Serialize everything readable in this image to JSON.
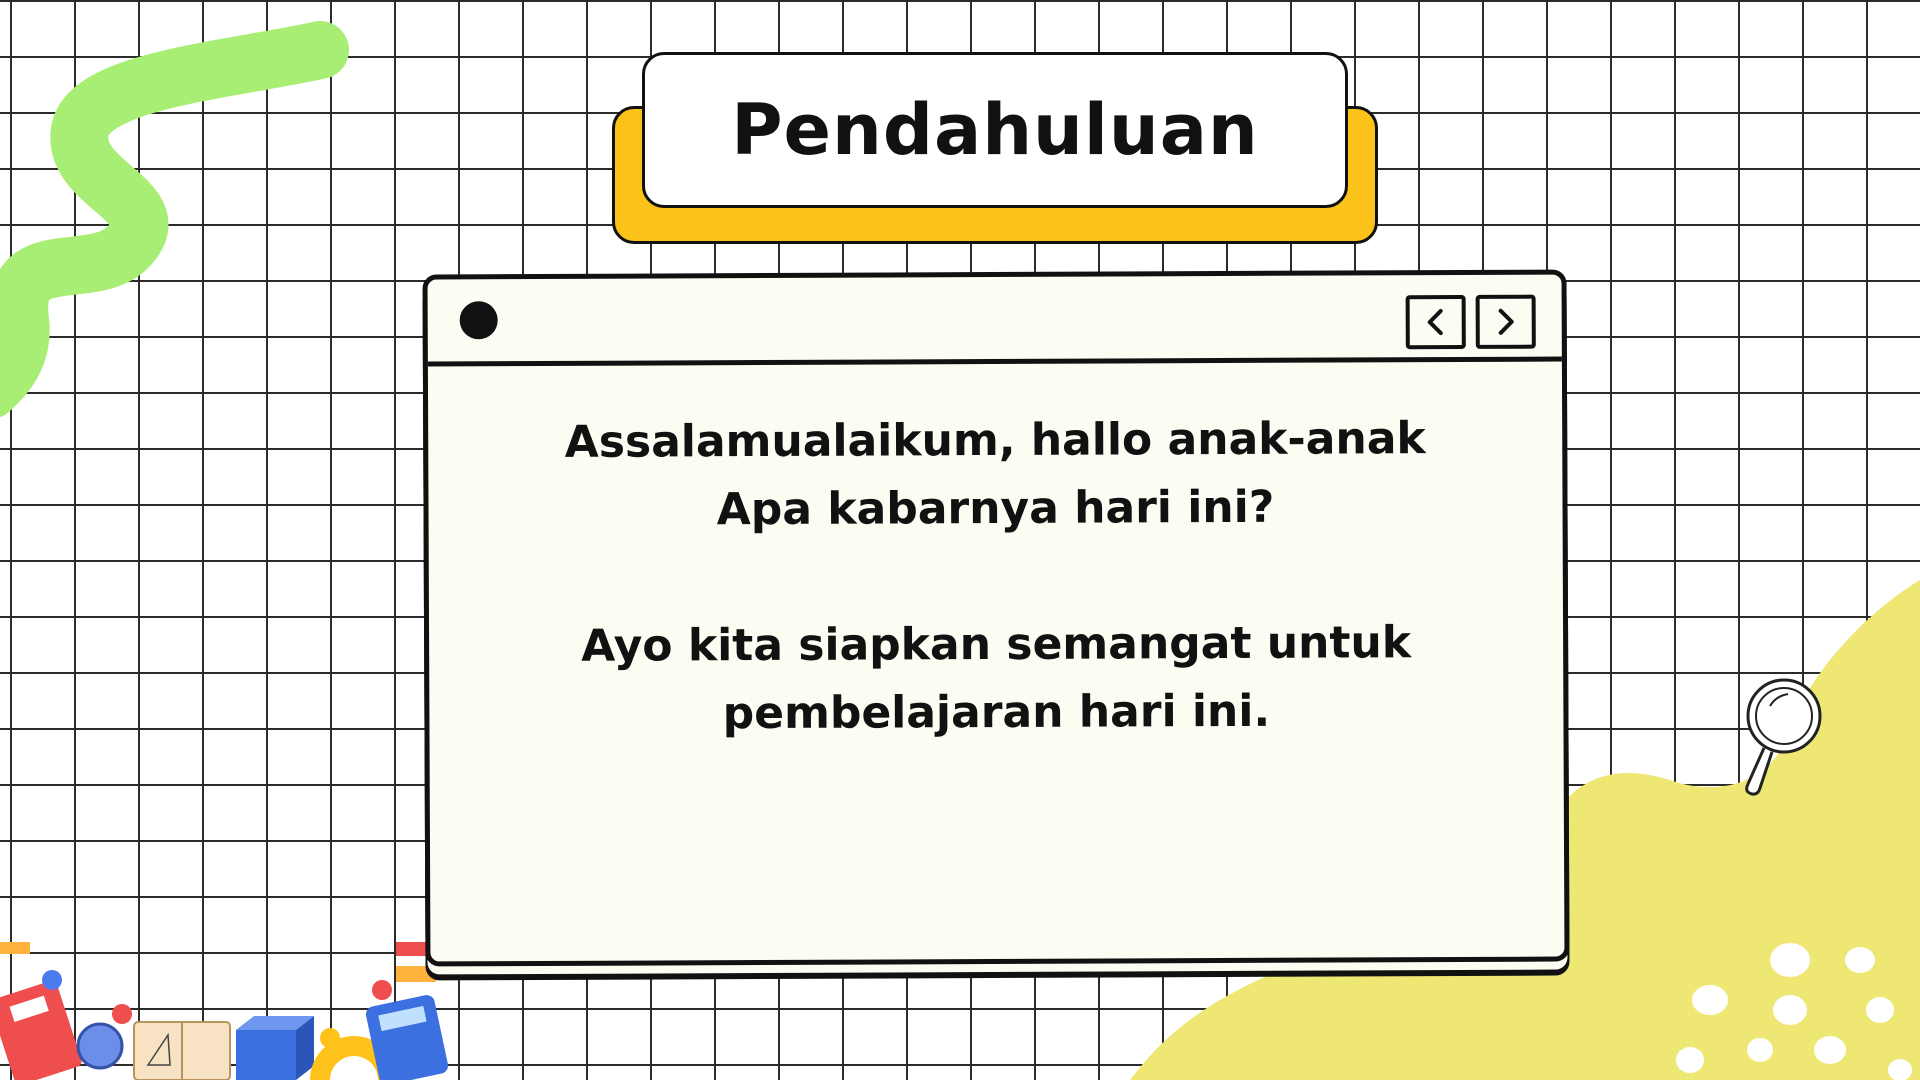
{
  "slide": {
    "title": "Pendahuluan",
    "lines": [
      "Assalamualaikum, hallo anak-anak",
      "Apa kabarnya hari ini?",
      "Ayo kita siapkan semangat untuk",
      "pembelajaran hari ini."
    ]
  },
  "window": {
    "prev_icon": "chevron-left-icon",
    "next_icon": "chevron-right-icon"
  },
  "decor": {
    "colors": {
      "grid": "#2b2b2b",
      "title_shadow": "#fbc219",
      "green_squiggle": "#a8ee74",
      "yellow_blob": "#eee774",
      "window_bg": "#fdfcf3"
    },
    "sticker_icons": [
      "notebook-icon",
      "ruler-icon",
      "book-icon",
      "cube-icon",
      "protractor-icon",
      "calculator-icon",
      "magnifier-icon"
    ]
  }
}
